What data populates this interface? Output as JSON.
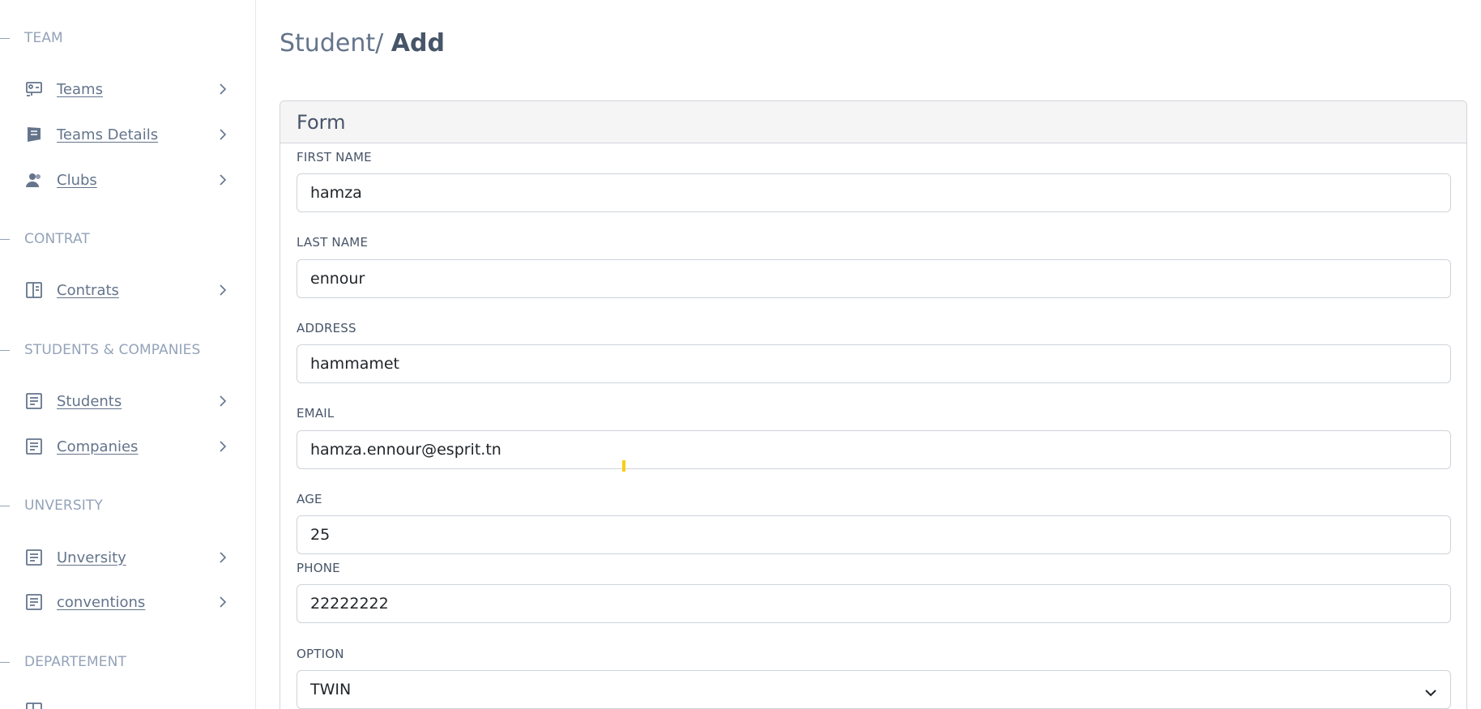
{
  "sidebar": {
    "sections": {
      "team": "TEAM",
      "contrat": "CONTRAT",
      "students_companies": "STUDENTS & COMPANIES",
      "unversity": "UNVERSITY",
      "departement": "DEPARTEMENT"
    },
    "items": {
      "teams": "Teams",
      "teams_details": "Teams Details",
      "clubs": "Clubs",
      "contrats": "Contrats",
      "students": "Students",
      "companies": "Companies",
      "unversity": "Unversity",
      "conventions": "conventions"
    }
  },
  "breadcrumb": {
    "parent": "Student/",
    "current": "Add"
  },
  "form": {
    "title": "Form",
    "first_name": {
      "label": "FIRST NAME",
      "value": "hamza"
    },
    "last_name": {
      "label": "LAST NAME",
      "value": "ennour"
    },
    "address": {
      "label": "ADDRESS",
      "value": "hammamet"
    },
    "email": {
      "label": "EMAIL",
      "value": "hamza.ennour@esprit.tn"
    },
    "age": {
      "label": "AGE",
      "value": "25"
    },
    "phone": {
      "label": "PHONE",
      "value": "22222222"
    },
    "option": {
      "label": "OPTION",
      "value": "TWIN"
    }
  },
  "colors": {
    "sidebar_text": "#64748b",
    "section_text": "#94a3b8",
    "card_header_bg": "#f5f5f5",
    "border": "#ced4da",
    "cursor_highlight": "#facc15"
  },
  "icons": {
    "teams": "presentation-icon",
    "teams_details": "notes-icon",
    "clubs": "users-icon",
    "contrats": "book-open-icon",
    "students": "document-list-icon",
    "companies": "document-list-icon",
    "unversity": "document-list-icon",
    "conventions": "document-list-icon",
    "select_caret": "chevron-down-icon"
  }
}
